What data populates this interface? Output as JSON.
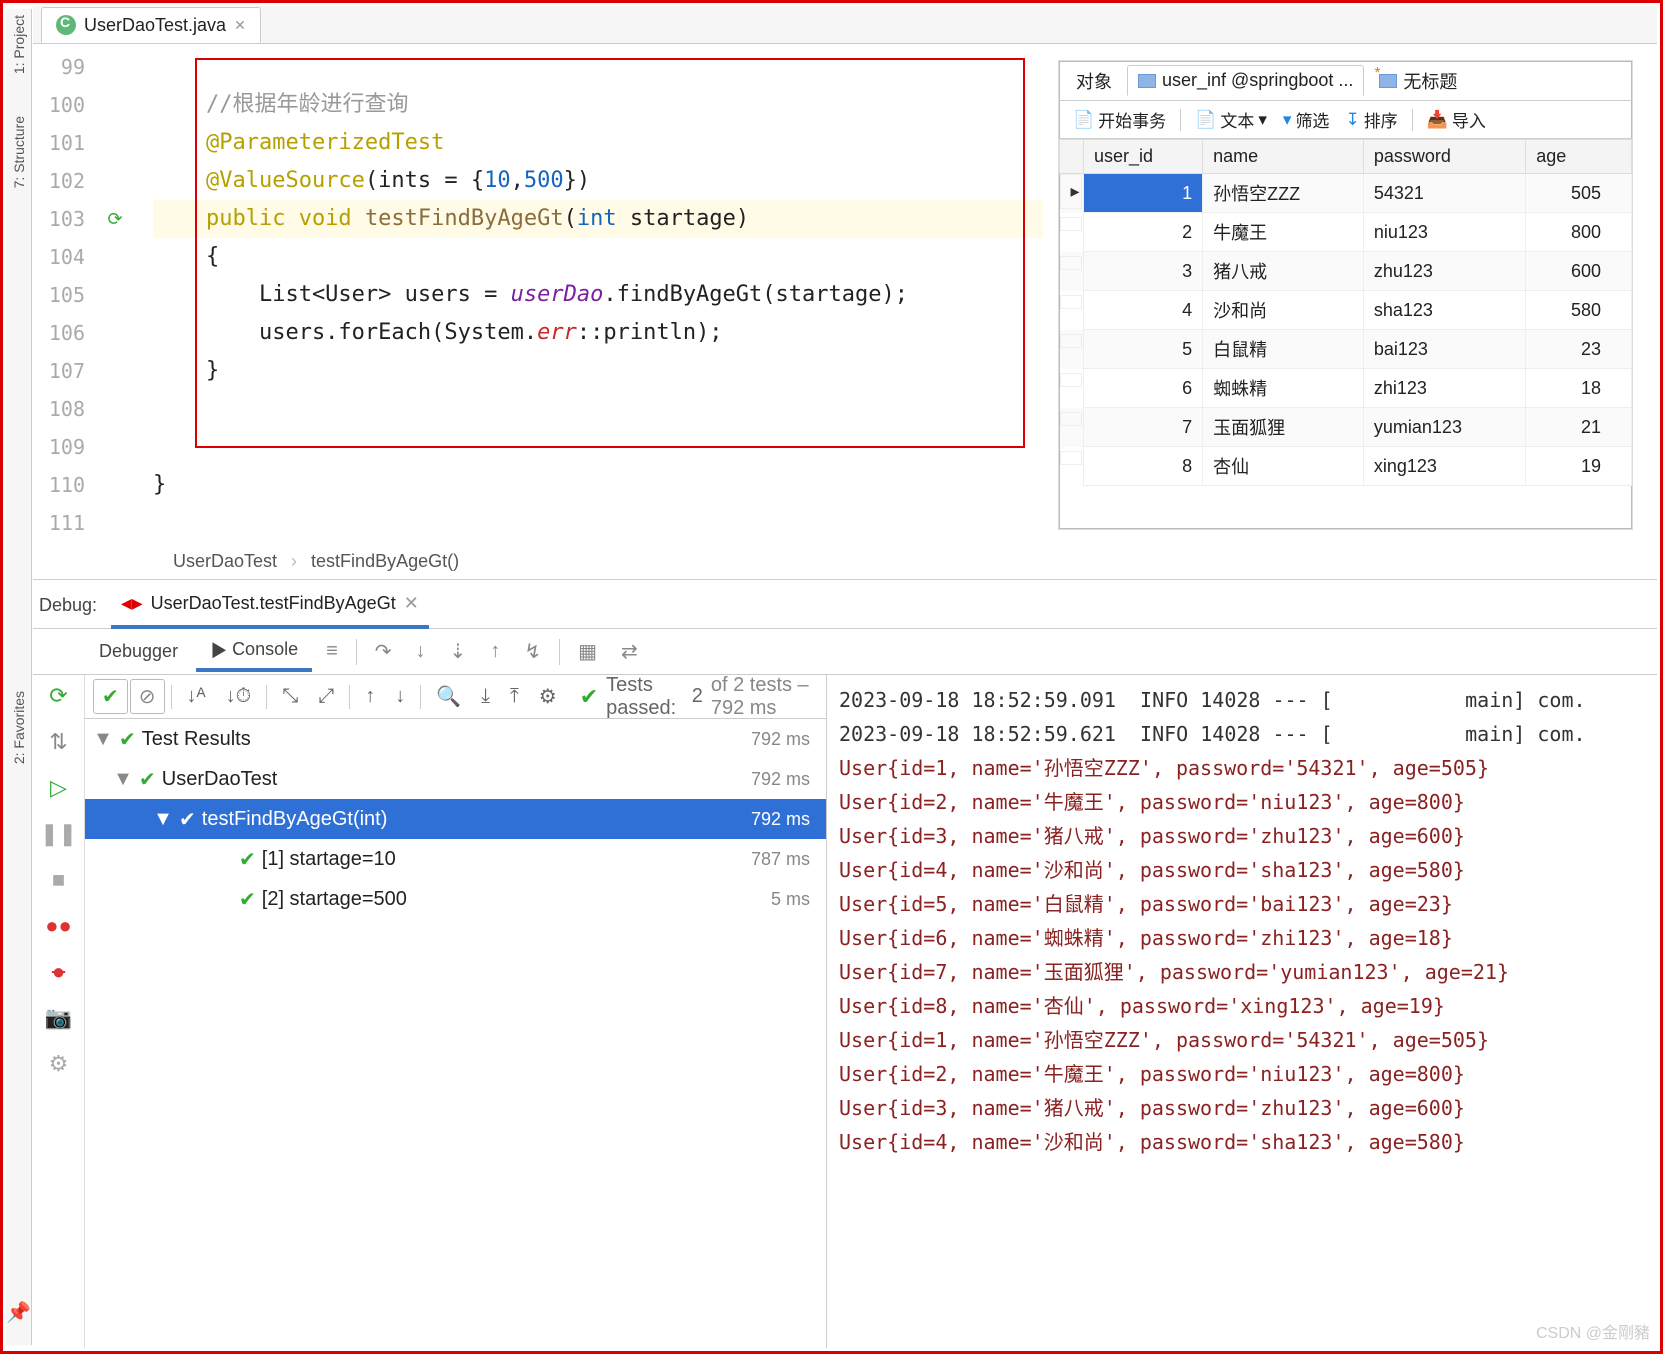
{
  "tab": {
    "filename": "UserDaoTest.java"
  },
  "gutter": [
    "99",
    "100",
    "101",
    "102",
    "103",
    "104",
    "105",
    "106",
    "107",
    "108",
    "109",
    "110",
    "111"
  ],
  "gutmark_row": 4,
  "code_lines": [
    {
      "html": ""
    },
    {
      "html": "    <span class='c-comment'>//根据年龄进行查询</span>"
    },
    {
      "html": "    <span class='c-anno'>@ParameterizedTest</span>"
    },
    {
      "html": "    <span class='c-anno'>@ValueSource</span>(ints = {<span class='c-num'>10</span>,<span class='c-num'>500</span>})"
    },
    {
      "html": "    <span class='c-kw'>public void</span> <span class='c-id'>testFindByAgeGt</span>(<span class='c-type'>int</span> startage)",
      "hl": true
    },
    {
      "html": "    {"
    },
    {
      "html": "        List&lt;User&gt; users = <span class='c-field'>userDao</span>.findByAgeGt(startage);"
    },
    {
      "html": "        users.forEach(System.<span class='c-err'>err</span>::println);"
    },
    {
      "html": "    }"
    },
    {
      "html": ""
    },
    {
      "html": ""
    },
    {
      "html": "}"
    },
    {
      "html": ""
    }
  ],
  "breadcrumb": {
    "class": "UserDaoTest",
    "method": "testFindByAgeGt()"
  },
  "db": {
    "tabs": [
      "对象",
      "user_inf @springboot ...",
      "无标题"
    ],
    "tools": {
      "begin": "开始事务",
      "text": "文本",
      "filter": "筛选",
      "sort": "排序",
      "import": "导入"
    },
    "columns": [
      "user_id",
      "name",
      "password",
      "age"
    ],
    "rows": [
      {
        "user_id": 1,
        "name": "孙悟空ZZZ",
        "password": "54321",
        "age": 505,
        "sel": true
      },
      {
        "user_id": 2,
        "name": "牛魔王",
        "password": "niu123",
        "age": 800
      },
      {
        "user_id": 3,
        "name": "猪八戒",
        "password": "zhu123",
        "age": 600
      },
      {
        "user_id": 4,
        "name": "沙和尚",
        "password": "sha123",
        "age": 580
      },
      {
        "user_id": 5,
        "name": "白鼠精",
        "password": "bai123",
        "age": 23
      },
      {
        "user_id": 6,
        "name": "蜘蛛精",
        "password": "zhi123",
        "age": 18
      },
      {
        "user_id": 7,
        "name": "玉面狐狸",
        "password": "yumian123",
        "age": 21
      },
      {
        "user_id": 8,
        "name": "杏仙",
        "password": "xing123",
        "age": 19
      }
    ]
  },
  "debug": {
    "label": "Debug:",
    "run_name": "UserDaoTest.testFindByAgeGt",
    "subtabs": {
      "debugger": "Debugger",
      "console": "Console"
    },
    "status": {
      "prefix": "Tests passed:",
      "cnt": "2",
      "of": "of 2 tests – 792 ms"
    }
  },
  "tree": [
    {
      "lvl": 0,
      "label": "Test Results",
      "time": "792 ms",
      "arrow": "▼"
    },
    {
      "lvl": 1,
      "label": "UserDaoTest",
      "time": "792 ms",
      "arrow": "▼"
    },
    {
      "lvl": 2,
      "label": "testFindByAgeGt(int)",
      "time": "792 ms",
      "arrow": "▼",
      "sel": true
    },
    {
      "lvl": 3,
      "label": "[1] startage=10",
      "time": "787 ms"
    },
    {
      "lvl": 3,
      "label": "[2] startage=500",
      "time": "5 ms"
    }
  ],
  "console_lines": [
    {
      "cls": "info",
      "t": "2023-09-18 18:52:59.091  INFO 14028 --- [           main] com."
    },
    {
      "cls": "info",
      "t": "2023-09-18 18:52:59.621  INFO 14028 --- [           main] com."
    },
    {
      "cls": "user",
      "t": "User{id=1, name='孙悟空ZZZ', password='54321', age=505}"
    },
    {
      "cls": "user",
      "t": "User{id=2, name='牛魔王', password='niu123', age=800}"
    },
    {
      "cls": "user",
      "t": "User{id=3, name='猪八戒', password='zhu123', age=600}"
    },
    {
      "cls": "user",
      "t": "User{id=4, name='沙和尚', password='sha123', age=580}"
    },
    {
      "cls": "user",
      "t": "User{id=5, name='白鼠精', password='bai123', age=23}"
    },
    {
      "cls": "user",
      "t": "User{id=6, name='蜘蛛精', password='zhi123', age=18}"
    },
    {
      "cls": "user",
      "t": "User{id=7, name='玉面狐狸', password='yumian123', age=21}"
    },
    {
      "cls": "user",
      "t": "User{id=8, name='杏仙', password='xing123', age=19}"
    },
    {
      "cls": "info",
      "t": ""
    },
    {
      "cls": "user",
      "t": "User{id=1, name='孙悟空ZZZ', password='54321', age=505}"
    },
    {
      "cls": "user",
      "t": "User{id=2, name='牛魔王', password='niu123', age=800}"
    },
    {
      "cls": "user",
      "t": "User{id=3, name='猪八戒', password='zhu123', age=600}"
    },
    {
      "cls": "user",
      "t": "User{id=4, name='沙和尚', password='sha123', age=580}"
    }
  ],
  "sidestrip": {
    "project": "1: Project",
    "structure": "7: Structure",
    "favorite": "2: Favorites"
  },
  "watermark": "CSDN @金剛豬"
}
